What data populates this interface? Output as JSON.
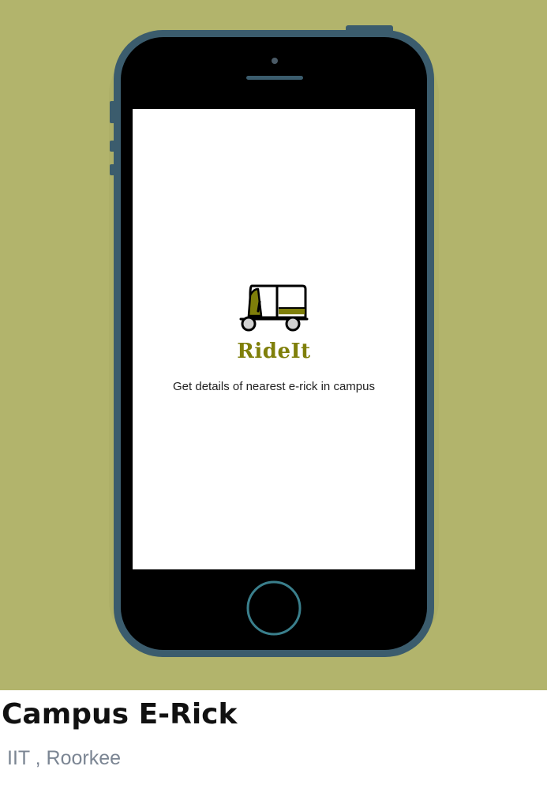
{
  "hero": {
    "background_color": "#b2b46c"
  },
  "phone": {
    "frame_color": "#3b5c6d",
    "bezel_color": "#000000",
    "home_button_ring_color": "#3a7f8c"
  },
  "splash": {
    "app_name": "RideIt",
    "tagline": "Get details of nearest e-rick in campus",
    "logo_icon": "e-rickshaw-icon",
    "brand_color": "#7f7f0a"
  },
  "project": {
    "title": "Campus E-Rick",
    "subtitle": "IIT , Roorkee"
  }
}
